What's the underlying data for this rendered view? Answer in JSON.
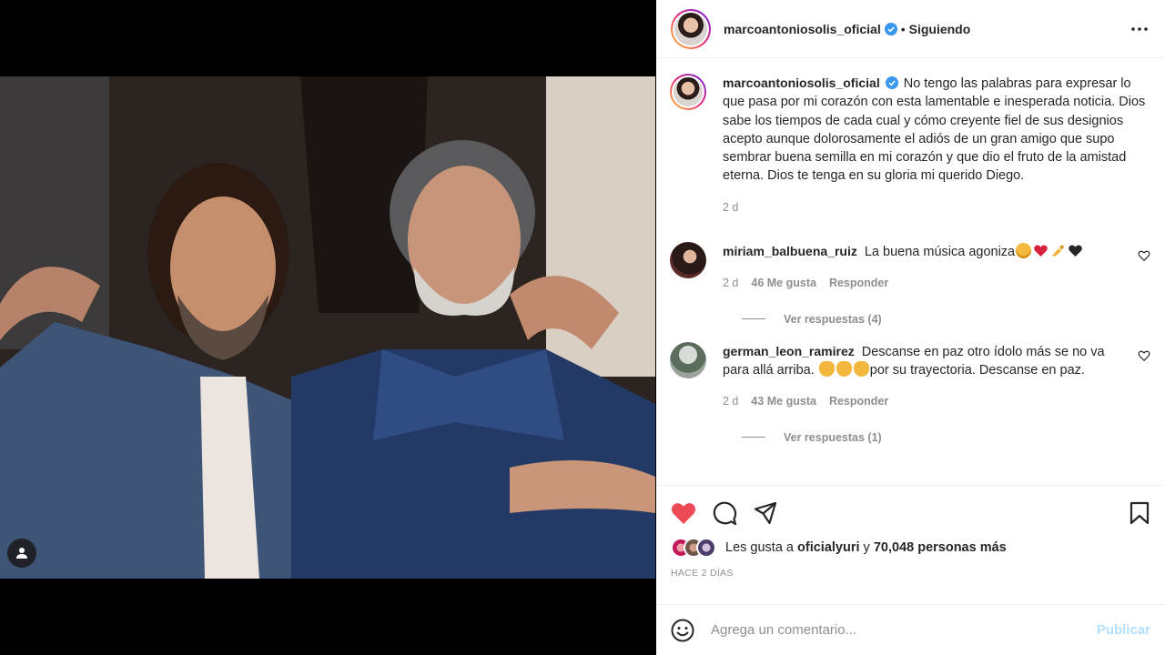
{
  "post": {
    "username": "marcoantoniosolis_oficial",
    "separator": "•",
    "following_label": "Siguiendo",
    "caption": "No tengo las palabras para expresar lo que pasa por mi corazón con esta lamentable e inesperada noticia. Dios sabe los tiempos de cada cual y cómo creyente fiel de sus designios acepto aunque dolorosamente el adiós de un gran amigo que supo sembrar buena semilla en mi corazón y que dio el fruto de la amistad eterna. Dios te tenga en su gloria mi querido Diego.",
    "caption_time": "2 d"
  },
  "comments": [
    {
      "username": "miriam_balbuena_ruiz",
      "text": "La buena música agoniza",
      "emojis": [
        "sad-face",
        "red-heart",
        "writing-hand",
        "black-heart"
      ],
      "time": "2 d",
      "likes": "46 Me gusta",
      "reply_label": "Responder",
      "view_replies": "Ver respuestas (4)"
    },
    {
      "username": "german_leon_ramirez",
      "text_before": "Descanse en paz otro ídolo más se no va para allá arriba.",
      "emojis": [
        "clapping-hands",
        "clapping-hands",
        "clapping-hands"
      ],
      "text_after": "por su trayectoria. Descanse en paz.",
      "time": "2 d",
      "likes": "43 Me gusta",
      "reply_label": "Responder",
      "view_replies": "Ver respuestas (1)"
    }
  ],
  "likes": {
    "prefix": "Les gusta a",
    "user": "oficialyuri",
    "conj": "y",
    "others": "70,048 personas más"
  },
  "posted_time": "HACE 2 DÍAS",
  "add_comment": {
    "placeholder": "Agrega un comentario...",
    "publish_label": "Publicar"
  },
  "colors": {
    "like_red": "#ed4956",
    "verified_blue": "#3897f0",
    "publish_disabled": "#b2dffc"
  }
}
